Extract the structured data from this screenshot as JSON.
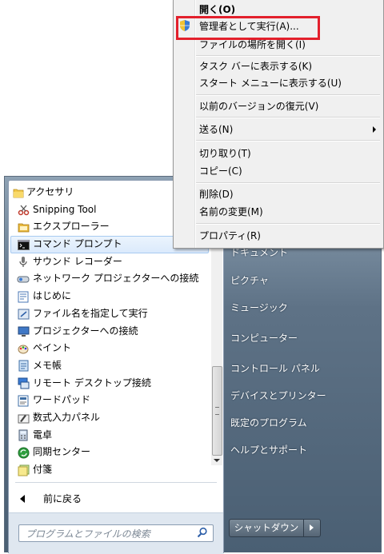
{
  "programs": [
    {
      "label": "アクセサリ",
      "icon": "folder-icon",
      "kind": "folder"
    },
    {
      "label": "Snipping Tool",
      "icon": "snipping-tool-icon"
    },
    {
      "label": "エクスプローラー",
      "icon": "explorer-folder-icon"
    },
    {
      "label": "コマンド プロンプト",
      "icon": "command-prompt-icon",
      "selected": true
    },
    {
      "label": "サウンド レコーダー",
      "icon": "microphone-icon"
    },
    {
      "label": "ネットワーク プロジェクターへの接続",
      "icon": "network-projector-icon"
    },
    {
      "label": "はじめに",
      "icon": "getting-started-icon"
    },
    {
      "label": "ファイル名を指定して実行",
      "icon": "run-icon"
    },
    {
      "label": "プロジェクターへの接続",
      "icon": "projector-icon"
    },
    {
      "label": "ペイント",
      "icon": "paint-icon"
    },
    {
      "label": "メモ帳",
      "icon": "notepad-icon"
    },
    {
      "label": "リモート デスクトップ接続",
      "icon": "remote-desktop-icon"
    },
    {
      "label": "ワードパッド",
      "icon": "wordpad-icon"
    },
    {
      "label": "数式入力パネル",
      "icon": "math-input-icon"
    },
    {
      "label": "電卓",
      "icon": "calculator-icon"
    },
    {
      "label": "同期センター",
      "icon": "sync-center-icon"
    },
    {
      "label": "付箋",
      "icon": "sticky-notes-icon"
    }
  ],
  "back": {
    "label": "前に戻る"
  },
  "search": {
    "placeholder": "プログラムとファイルの検索"
  },
  "right_links": [
    "ドキュメント",
    "ピクチャ",
    "ミュージック",
    "コンピューター",
    "コントロール パネル",
    "デバイスとプリンター",
    "既定のプログラム",
    "ヘルプとサポート"
  ],
  "shutdown": {
    "label": "シャットダウン"
  },
  "context_menu": {
    "open": "開く(O)",
    "run_as_admin": "管理者として実行(A)...",
    "open_location": "ファイルの場所を開く(I)",
    "pin_taskbar": "タスク バーに表示する(K)",
    "pin_start": "スタート メニューに表示する(U)",
    "restore_versions": "以前のバージョンの復元(V)",
    "send_to": "送る(N)",
    "cut": "切り取り(T)",
    "copy": "コピー(C)",
    "delete": "削除(D)",
    "rename": "名前の変更(M)",
    "properties": "プロパティ(R)"
  },
  "colors": {
    "highlight_border": "#e3202c",
    "selection_fill": "#dbeafc"
  }
}
